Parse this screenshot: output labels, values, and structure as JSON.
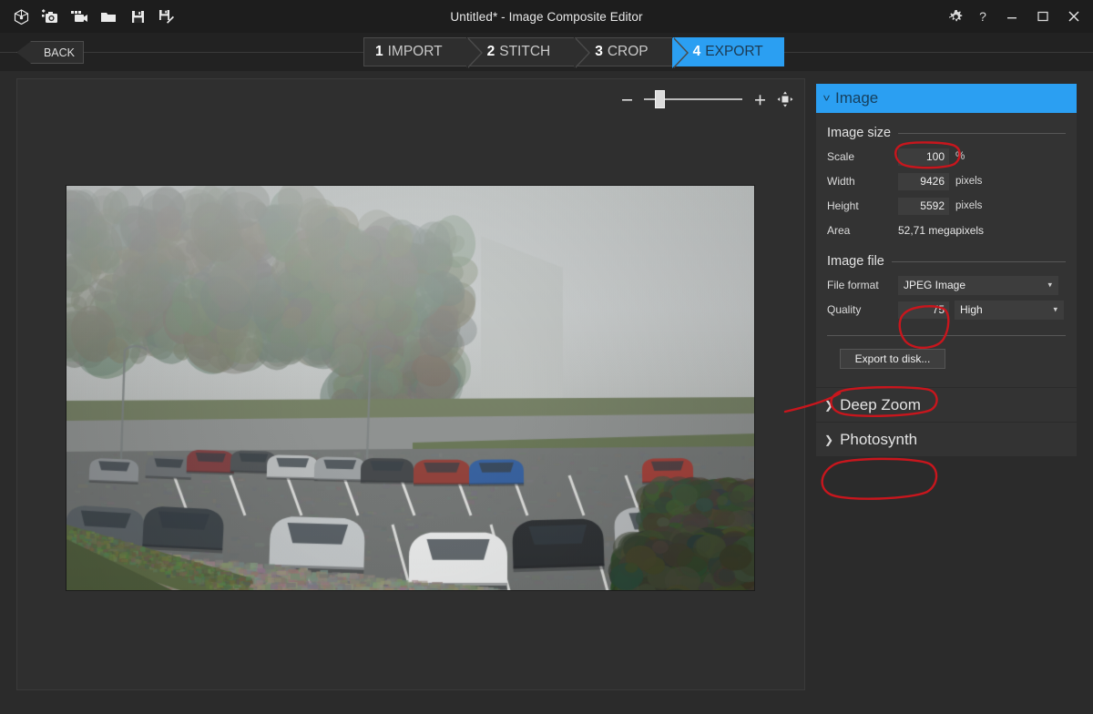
{
  "titlebar": {
    "title": "Untitled* - Image Composite Editor",
    "toolbar_icons": [
      "new-composition-icon",
      "new-from-camera-icon",
      "new-from-video-icon",
      "open-folder-icon",
      "save-icon",
      "save-as-icon"
    ],
    "settings_icon": "gear-icon",
    "help_icon": "question-mark-icon",
    "minimize_icon": "minimize-icon",
    "maximize_icon": "maximize-icon",
    "close_icon": "close-icon"
  },
  "nav": {
    "back_label": "BACK",
    "steps": [
      {
        "num": "1",
        "label": "IMPORT",
        "active": false
      },
      {
        "num": "2",
        "label": "STITCH",
        "active": false
      },
      {
        "num": "3",
        "label": "CROP",
        "active": false
      },
      {
        "num": "4",
        "label": "EXPORT",
        "active": true
      }
    ]
  },
  "canvas": {
    "zoom_out_icon": "minus-icon",
    "zoom_in_icon": "plus-icon",
    "fit_to_window_icon": "fit-to-window-icon",
    "zoom_value": 12
  },
  "panel": {
    "header": {
      "label": "Image",
      "chevron": "chevron-down-icon",
      "accent": "#2b9ff2"
    },
    "image_size": {
      "title": "Image size",
      "scale_label": "Scale",
      "scale_value": "100",
      "scale_unit": "%",
      "width_label": "Width",
      "width_value": "9426",
      "width_unit": "pixels",
      "height_label": "Height",
      "height_value": "5592",
      "height_unit": "pixels",
      "area_label": "Area",
      "area_value": "52,71 megapixels"
    },
    "image_file": {
      "title": "Image file",
      "file_format_label": "File format",
      "file_format_value": "JPEG Image",
      "quality_label": "Quality",
      "quality_value": "75",
      "quality_preset": "High",
      "dropdown_icon": "chevron-down-icon"
    },
    "export_button": "Export to disk...",
    "accordions": [
      {
        "label": "Deep Zoom",
        "chevron": "chevron-right-icon"
      },
      {
        "label": "Photosynth",
        "chevron": "chevron-right-icon"
      }
    ]
  },
  "annotations": {
    "color": "#c8161d",
    "marks": [
      "scale-field-circle",
      "quality-field-circle",
      "export-button-circle-arrow",
      "photosynth-circle"
    ]
  }
}
